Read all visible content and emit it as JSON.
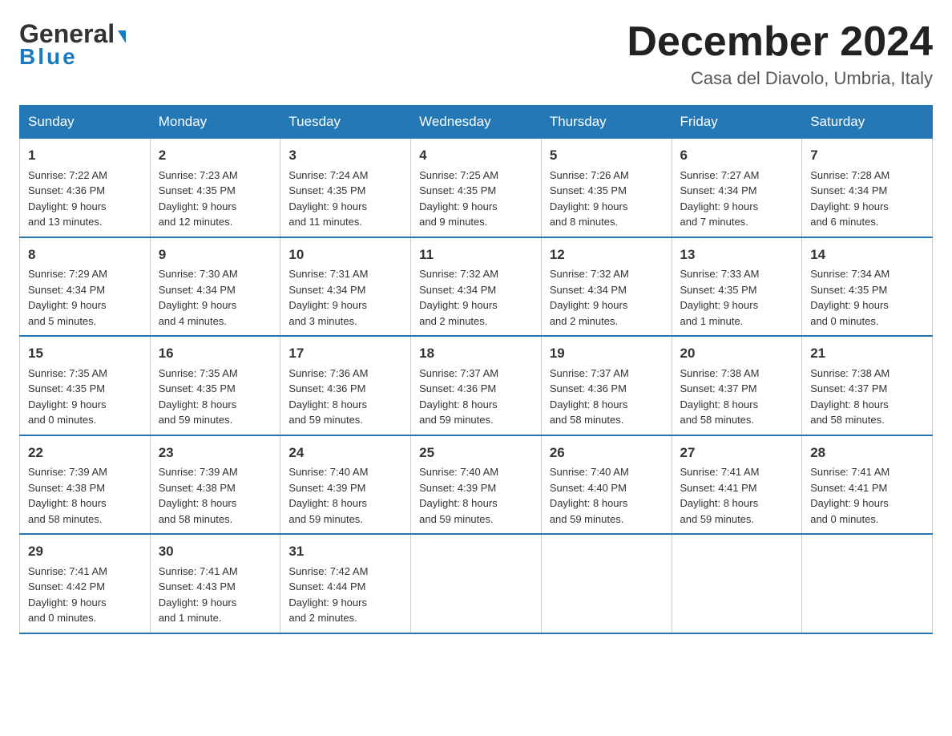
{
  "header": {
    "logo_general": "General",
    "logo_blue": "Blue",
    "month_title": "December 2024",
    "location": "Casa del Diavolo, Umbria, Italy"
  },
  "weekdays": [
    "Sunday",
    "Monday",
    "Tuesday",
    "Wednesday",
    "Thursday",
    "Friday",
    "Saturday"
  ],
  "weeks": [
    [
      {
        "day": "1",
        "sunrise": "7:22 AM",
        "sunset": "4:36 PM",
        "daylight": "9 hours and 13 minutes."
      },
      {
        "day": "2",
        "sunrise": "7:23 AM",
        "sunset": "4:35 PM",
        "daylight": "9 hours and 12 minutes."
      },
      {
        "day": "3",
        "sunrise": "7:24 AM",
        "sunset": "4:35 PM",
        "daylight": "9 hours and 11 minutes."
      },
      {
        "day": "4",
        "sunrise": "7:25 AM",
        "sunset": "4:35 PM",
        "daylight": "9 hours and 9 minutes."
      },
      {
        "day": "5",
        "sunrise": "7:26 AM",
        "sunset": "4:35 PM",
        "daylight": "9 hours and 8 minutes."
      },
      {
        "day": "6",
        "sunrise": "7:27 AM",
        "sunset": "4:34 PM",
        "daylight": "9 hours and 7 minutes."
      },
      {
        "day": "7",
        "sunrise": "7:28 AM",
        "sunset": "4:34 PM",
        "daylight": "9 hours and 6 minutes."
      }
    ],
    [
      {
        "day": "8",
        "sunrise": "7:29 AM",
        "sunset": "4:34 PM",
        "daylight": "9 hours and 5 minutes."
      },
      {
        "day": "9",
        "sunrise": "7:30 AM",
        "sunset": "4:34 PM",
        "daylight": "9 hours and 4 minutes."
      },
      {
        "day": "10",
        "sunrise": "7:31 AM",
        "sunset": "4:34 PM",
        "daylight": "9 hours and 3 minutes."
      },
      {
        "day": "11",
        "sunrise": "7:32 AM",
        "sunset": "4:34 PM",
        "daylight": "9 hours and 2 minutes."
      },
      {
        "day": "12",
        "sunrise": "7:32 AM",
        "sunset": "4:34 PM",
        "daylight": "9 hours and 2 minutes."
      },
      {
        "day": "13",
        "sunrise": "7:33 AM",
        "sunset": "4:35 PM",
        "daylight": "9 hours and 1 minute."
      },
      {
        "day": "14",
        "sunrise": "7:34 AM",
        "sunset": "4:35 PM",
        "daylight": "9 hours and 0 minutes."
      }
    ],
    [
      {
        "day": "15",
        "sunrise": "7:35 AM",
        "sunset": "4:35 PM",
        "daylight": "9 hours and 0 minutes."
      },
      {
        "day": "16",
        "sunrise": "7:35 AM",
        "sunset": "4:35 PM",
        "daylight": "8 hours and 59 minutes."
      },
      {
        "day": "17",
        "sunrise": "7:36 AM",
        "sunset": "4:36 PM",
        "daylight": "8 hours and 59 minutes."
      },
      {
        "day": "18",
        "sunrise": "7:37 AM",
        "sunset": "4:36 PM",
        "daylight": "8 hours and 59 minutes."
      },
      {
        "day": "19",
        "sunrise": "7:37 AM",
        "sunset": "4:36 PM",
        "daylight": "8 hours and 58 minutes."
      },
      {
        "day": "20",
        "sunrise": "7:38 AM",
        "sunset": "4:37 PM",
        "daylight": "8 hours and 58 minutes."
      },
      {
        "day": "21",
        "sunrise": "7:38 AM",
        "sunset": "4:37 PM",
        "daylight": "8 hours and 58 minutes."
      }
    ],
    [
      {
        "day": "22",
        "sunrise": "7:39 AM",
        "sunset": "4:38 PM",
        "daylight": "8 hours and 58 minutes."
      },
      {
        "day": "23",
        "sunrise": "7:39 AM",
        "sunset": "4:38 PM",
        "daylight": "8 hours and 58 minutes."
      },
      {
        "day": "24",
        "sunrise": "7:40 AM",
        "sunset": "4:39 PM",
        "daylight": "8 hours and 59 minutes."
      },
      {
        "day": "25",
        "sunrise": "7:40 AM",
        "sunset": "4:39 PM",
        "daylight": "8 hours and 59 minutes."
      },
      {
        "day": "26",
        "sunrise": "7:40 AM",
        "sunset": "4:40 PM",
        "daylight": "8 hours and 59 minutes."
      },
      {
        "day": "27",
        "sunrise": "7:41 AM",
        "sunset": "4:41 PM",
        "daylight": "8 hours and 59 minutes."
      },
      {
        "day": "28",
        "sunrise": "7:41 AM",
        "sunset": "4:41 PM",
        "daylight": "9 hours and 0 minutes."
      }
    ],
    [
      {
        "day": "29",
        "sunrise": "7:41 AM",
        "sunset": "4:42 PM",
        "daylight": "9 hours and 0 minutes."
      },
      {
        "day": "30",
        "sunrise": "7:41 AM",
        "sunset": "4:43 PM",
        "daylight": "9 hours and 1 minute."
      },
      {
        "day": "31",
        "sunrise": "7:42 AM",
        "sunset": "4:44 PM",
        "daylight": "9 hours and 2 minutes."
      },
      null,
      null,
      null,
      null
    ]
  ],
  "labels": {
    "sunrise": "Sunrise:",
    "sunset": "Sunset:",
    "daylight": "Daylight:"
  }
}
